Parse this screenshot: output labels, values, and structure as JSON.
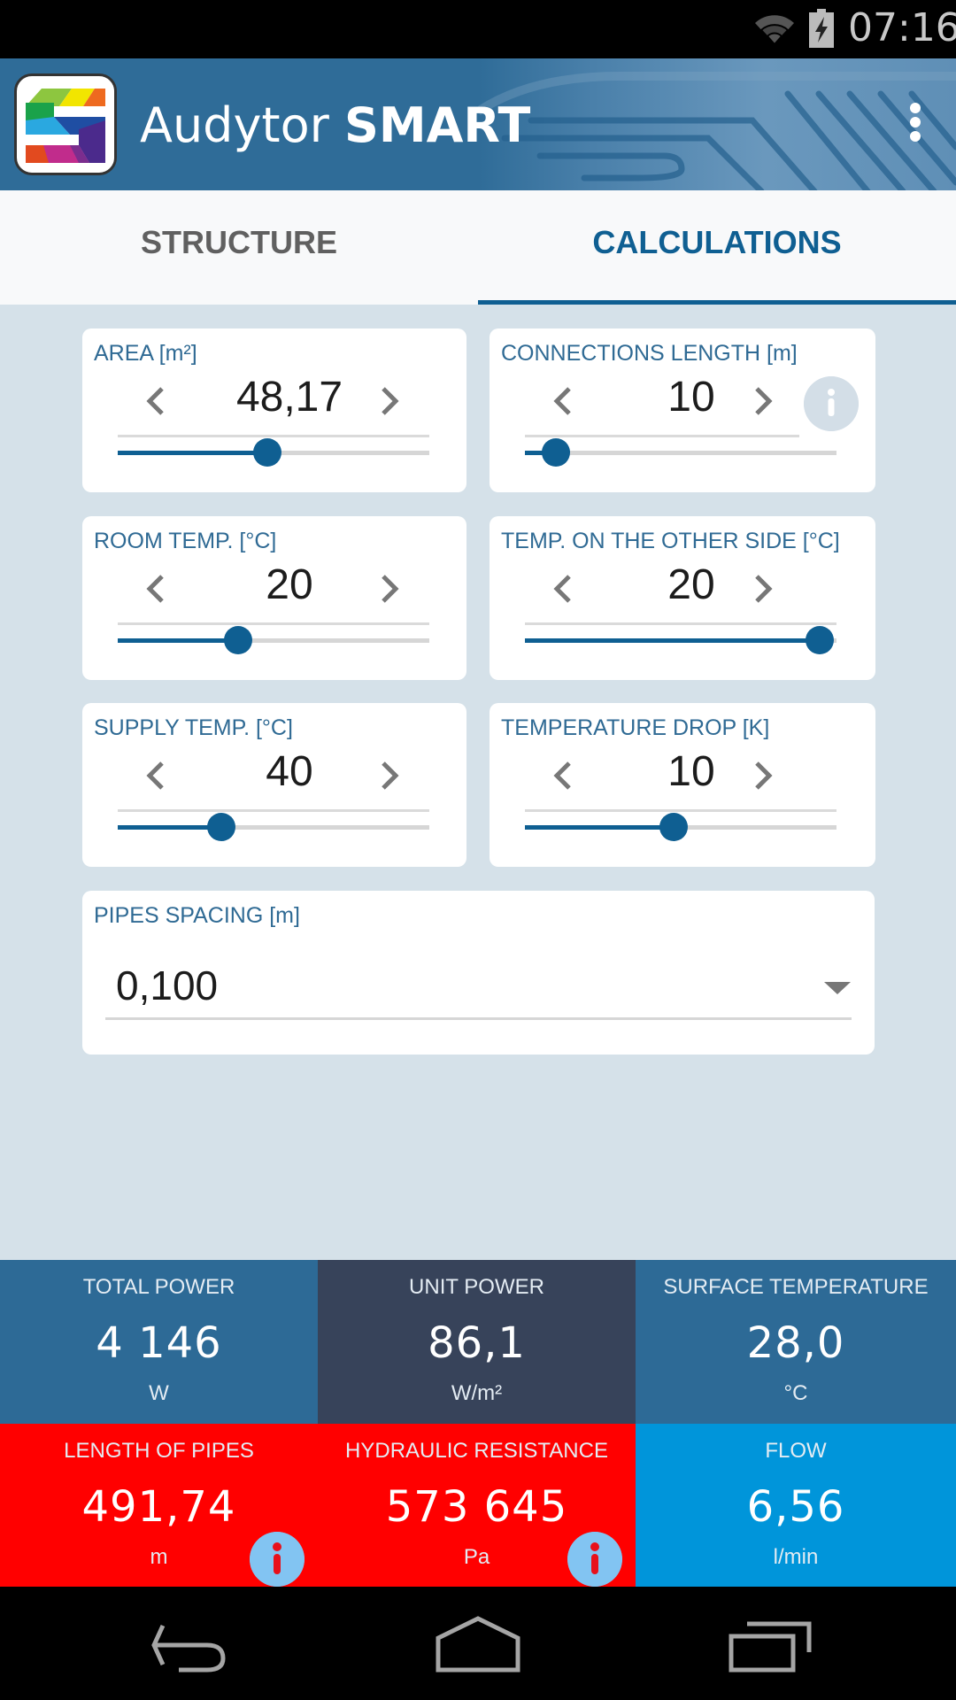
{
  "status_bar": {
    "time": "07:16",
    "icons": [
      "wifi-icon",
      "battery-charging-icon"
    ]
  },
  "app_bar": {
    "title_regular": "Audytor ",
    "title_bold": "SMART",
    "logo": "audytor-smart-logo",
    "menu_icon": "overflow-menu-icon"
  },
  "tabs": [
    {
      "label": "STRUCTURE",
      "active": false
    },
    {
      "label": "CALCULATIONS",
      "active": true
    }
  ],
  "inputs": [
    {
      "label": "AREA [m²]",
      "value": "48,17",
      "slider_fraction": 0.48,
      "has_info": false
    },
    {
      "label": "CONNECTIONS LENGTH [m]",
      "value": "10",
      "slider_fraction": 0.1,
      "has_info": true
    },
    {
      "label": "ROOM TEMP. [°C]",
      "value": "20",
      "slider_fraction": 0.385,
      "has_info": false
    },
    {
      "label": "TEMP. ON THE OTHER SIDE [°C]",
      "value": "20",
      "slider_fraction": 0.945,
      "has_info": false
    },
    {
      "label": "SUPPLY TEMP. [°C]",
      "value": "40",
      "slider_fraction": 0.333,
      "has_info": false
    },
    {
      "label": "TEMPERATURE DROP [K]",
      "value": "10",
      "slider_fraction": 0.476,
      "has_info": false
    }
  ],
  "pipes_spacing": {
    "label": "PIPES SPACING [m]",
    "selected": "0,100"
  },
  "results": [
    {
      "label": "TOTAL POWER",
      "value": "4 146",
      "unit": "W",
      "color": "#2d6a96",
      "info": false
    },
    {
      "label": "UNIT POWER",
      "value": "86,1",
      "unit": "W/m²",
      "color": "#37435a",
      "info": false
    },
    {
      "label": "SURFACE TEMPERATURE",
      "value": "28,0",
      "unit": "°C",
      "color": "#2d6a96",
      "info": false
    },
    {
      "label": "LENGTH OF PIPES",
      "value": "491,74",
      "unit": "m",
      "color": "#ff0000",
      "info": true
    },
    {
      "label": "HYDRAULIC RESISTANCE",
      "value": "573 645",
      "unit": "Pa",
      "color": "#ff0000",
      "info": true
    },
    {
      "label": "FLOW",
      "value": "6,56",
      "unit": "l/min",
      "color": "#0095da",
      "info": false
    }
  ],
  "nav_bar": {
    "buttons": [
      "back-icon",
      "home-icon",
      "recents-icon"
    ]
  },
  "colors": {
    "accent": "#0f5f92",
    "label": "#2f6a94",
    "background": "#d5e1e9",
    "alert": "#ff0000",
    "info_icon": "#82c4f2"
  }
}
